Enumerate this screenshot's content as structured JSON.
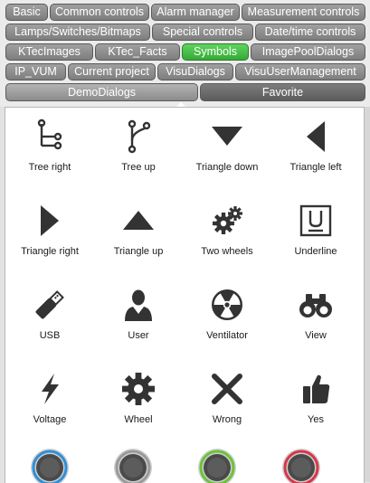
{
  "tabs": {
    "row1": [
      "Basic",
      "Common controls",
      "Alarm manager",
      "Measurement controls"
    ],
    "row2": [
      "Lamps/Switches/Bitmaps",
      "Special controls",
      "Date/time controls"
    ],
    "row3": [
      "KTecImages",
      "KTec_Facts",
      "Symbols",
      "ImagePoolDialogs"
    ],
    "row4": [
      "IP_VUM",
      "Current project",
      "VisuDialogs",
      "VisuUserManagement"
    ],
    "row5": [
      "DemoDialogs",
      "Favorite"
    ],
    "active": "Symbols"
  },
  "symbols": [
    {
      "label": "Tree right",
      "icon": "tree-right-icon"
    },
    {
      "label": "Tree up",
      "icon": "tree-up-icon"
    },
    {
      "label": "Triangle down",
      "icon": "triangle-down-icon"
    },
    {
      "label": "Triangle left",
      "icon": "triangle-left-icon"
    },
    {
      "label": "Triangle right",
      "icon": "triangle-right-icon"
    },
    {
      "label": "Triangle up",
      "icon": "triangle-up-icon"
    },
    {
      "label": "Two wheels",
      "icon": "two-wheels-icon"
    },
    {
      "label": "Underline",
      "icon": "underline-icon"
    },
    {
      "label": "USB",
      "icon": "usb-icon"
    },
    {
      "label": "User",
      "icon": "user-icon"
    },
    {
      "label": "Ventilator",
      "icon": "ventilator-icon"
    },
    {
      "label": "View",
      "icon": "binoculars-icon"
    },
    {
      "label": "Voltage",
      "icon": "voltage-icon"
    },
    {
      "label": "Wheel",
      "icon": "wheel-icon"
    },
    {
      "label": "Wrong",
      "icon": "wrong-icon"
    },
    {
      "label": "Yes",
      "icon": "thumbs-up-icon"
    }
  ],
  "knobs": [
    {
      "icon": "knob-blue-icon",
      "ring_color": "#2f8fd8"
    },
    {
      "icon": "knob-gray-icon",
      "ring_color": "#9a9a9a"
    },
    {
      "icon": "knob-green-icon",
      "ring_color": "#6cc33a"
    },
    {
      "icon": "knob-red-icon",
      "ring_color": "#d8364a"
    }
  ],
  "colors": {
    "tab_bg": "#8c8c8c",
    "tab_active": "#3fbf3f",
    "icon_color": "#333333"
  }
}
